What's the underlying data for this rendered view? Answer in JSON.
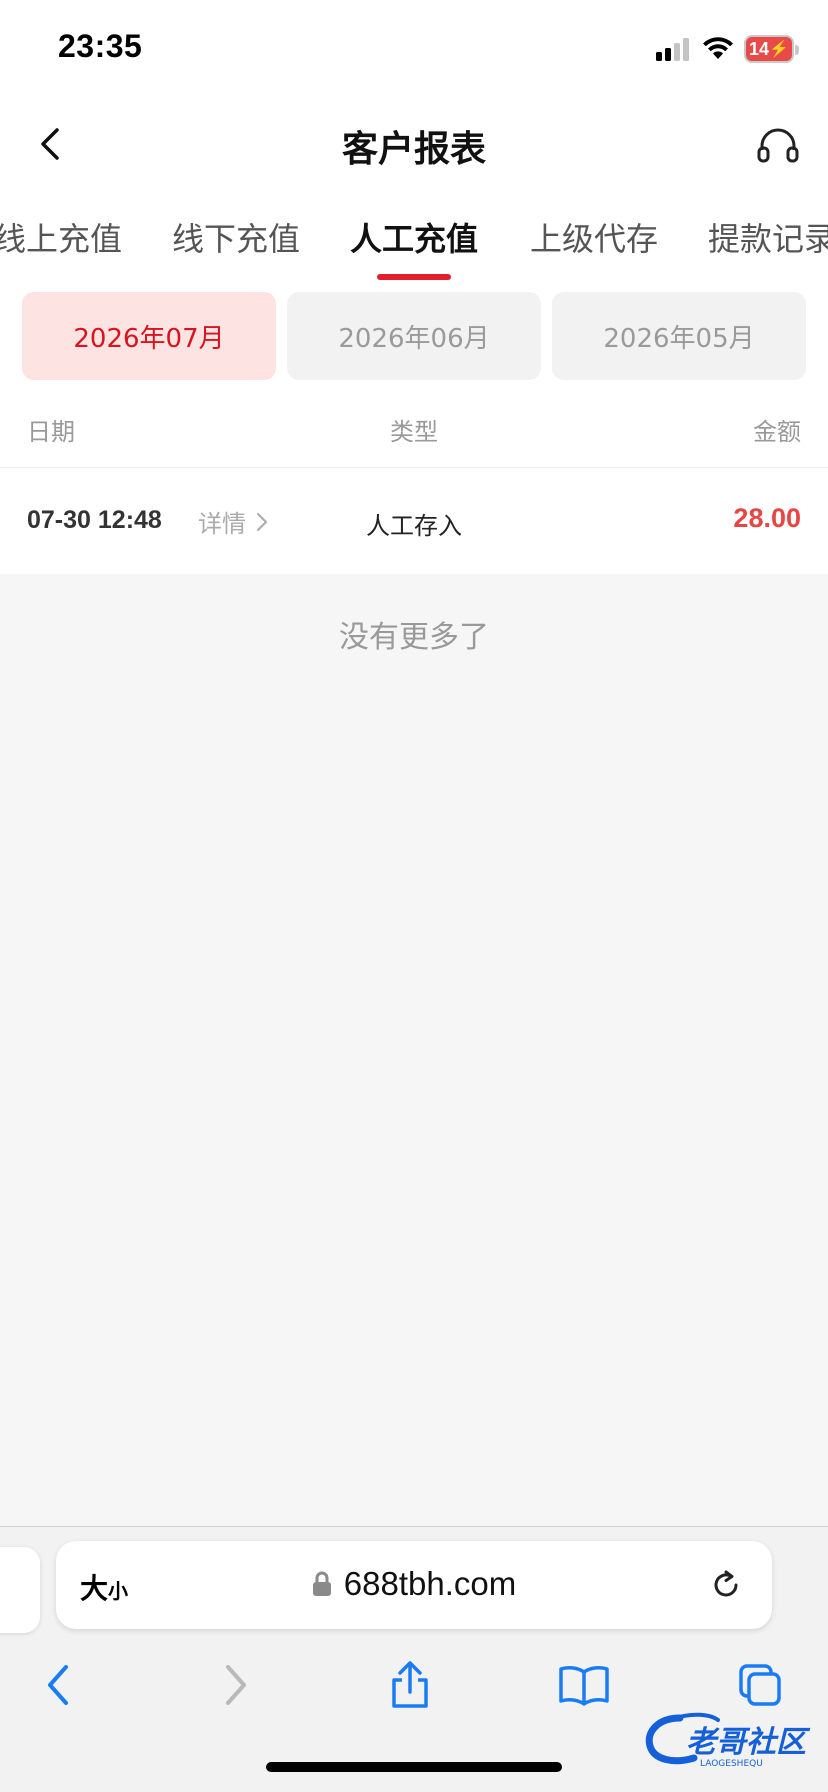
{
  "status_bar": {
    "time": "23:35",
    "battery": "14"
  },
  "nav": {
    "title": "客户报表",
    "back_icon": "chevron-left-icon",
    "support_icon": "headset-icon"
  },
  "tabs": [
    {
      "label": "线上充值",
      "active": false
    },
    {
      "label": "线下充值",
      "active": false
    },
    {
      "label": "人工充值",
      "active": true
    },
    {
      "label": "上级代存",
      "active": false
    },
    {
      "label": "提款记录",
      "active": false
    }
  ],
  "months": [
    {
      "label": "2026年07月",
      "active": true
    },
    {
      "label": "2026年06月",
      "active": false
    },
    {
      "label": "2026年05月",
      "active": false
    }
  ],
  "table": {
    "headers": {
      "date": "日期",
      "type": "类型",
      "amount": "金额"
    },
    "rows": [
      {
        "date": "07-30 12:48",
        "detail": "详情",
        "type": "人工存入",
        "amount": "28.00"
      }
    ],
    "no_more": "没有更多了"
  },
  "browser": {
    "text_size_label": "大",
    "text_size_small": "小",
    "url": "688tbh.com"
  },
  "watermark": {
    "text": "老哥社区",
    "subtext": "LAOGESHEQU"
  },
  "colors": {
    "accent": "#e21f2a",
    "amount": "#e84545",
    "active_month_bg": "#fde3e1",
    "safari_blue": "#1a7cf5"
  }
}
